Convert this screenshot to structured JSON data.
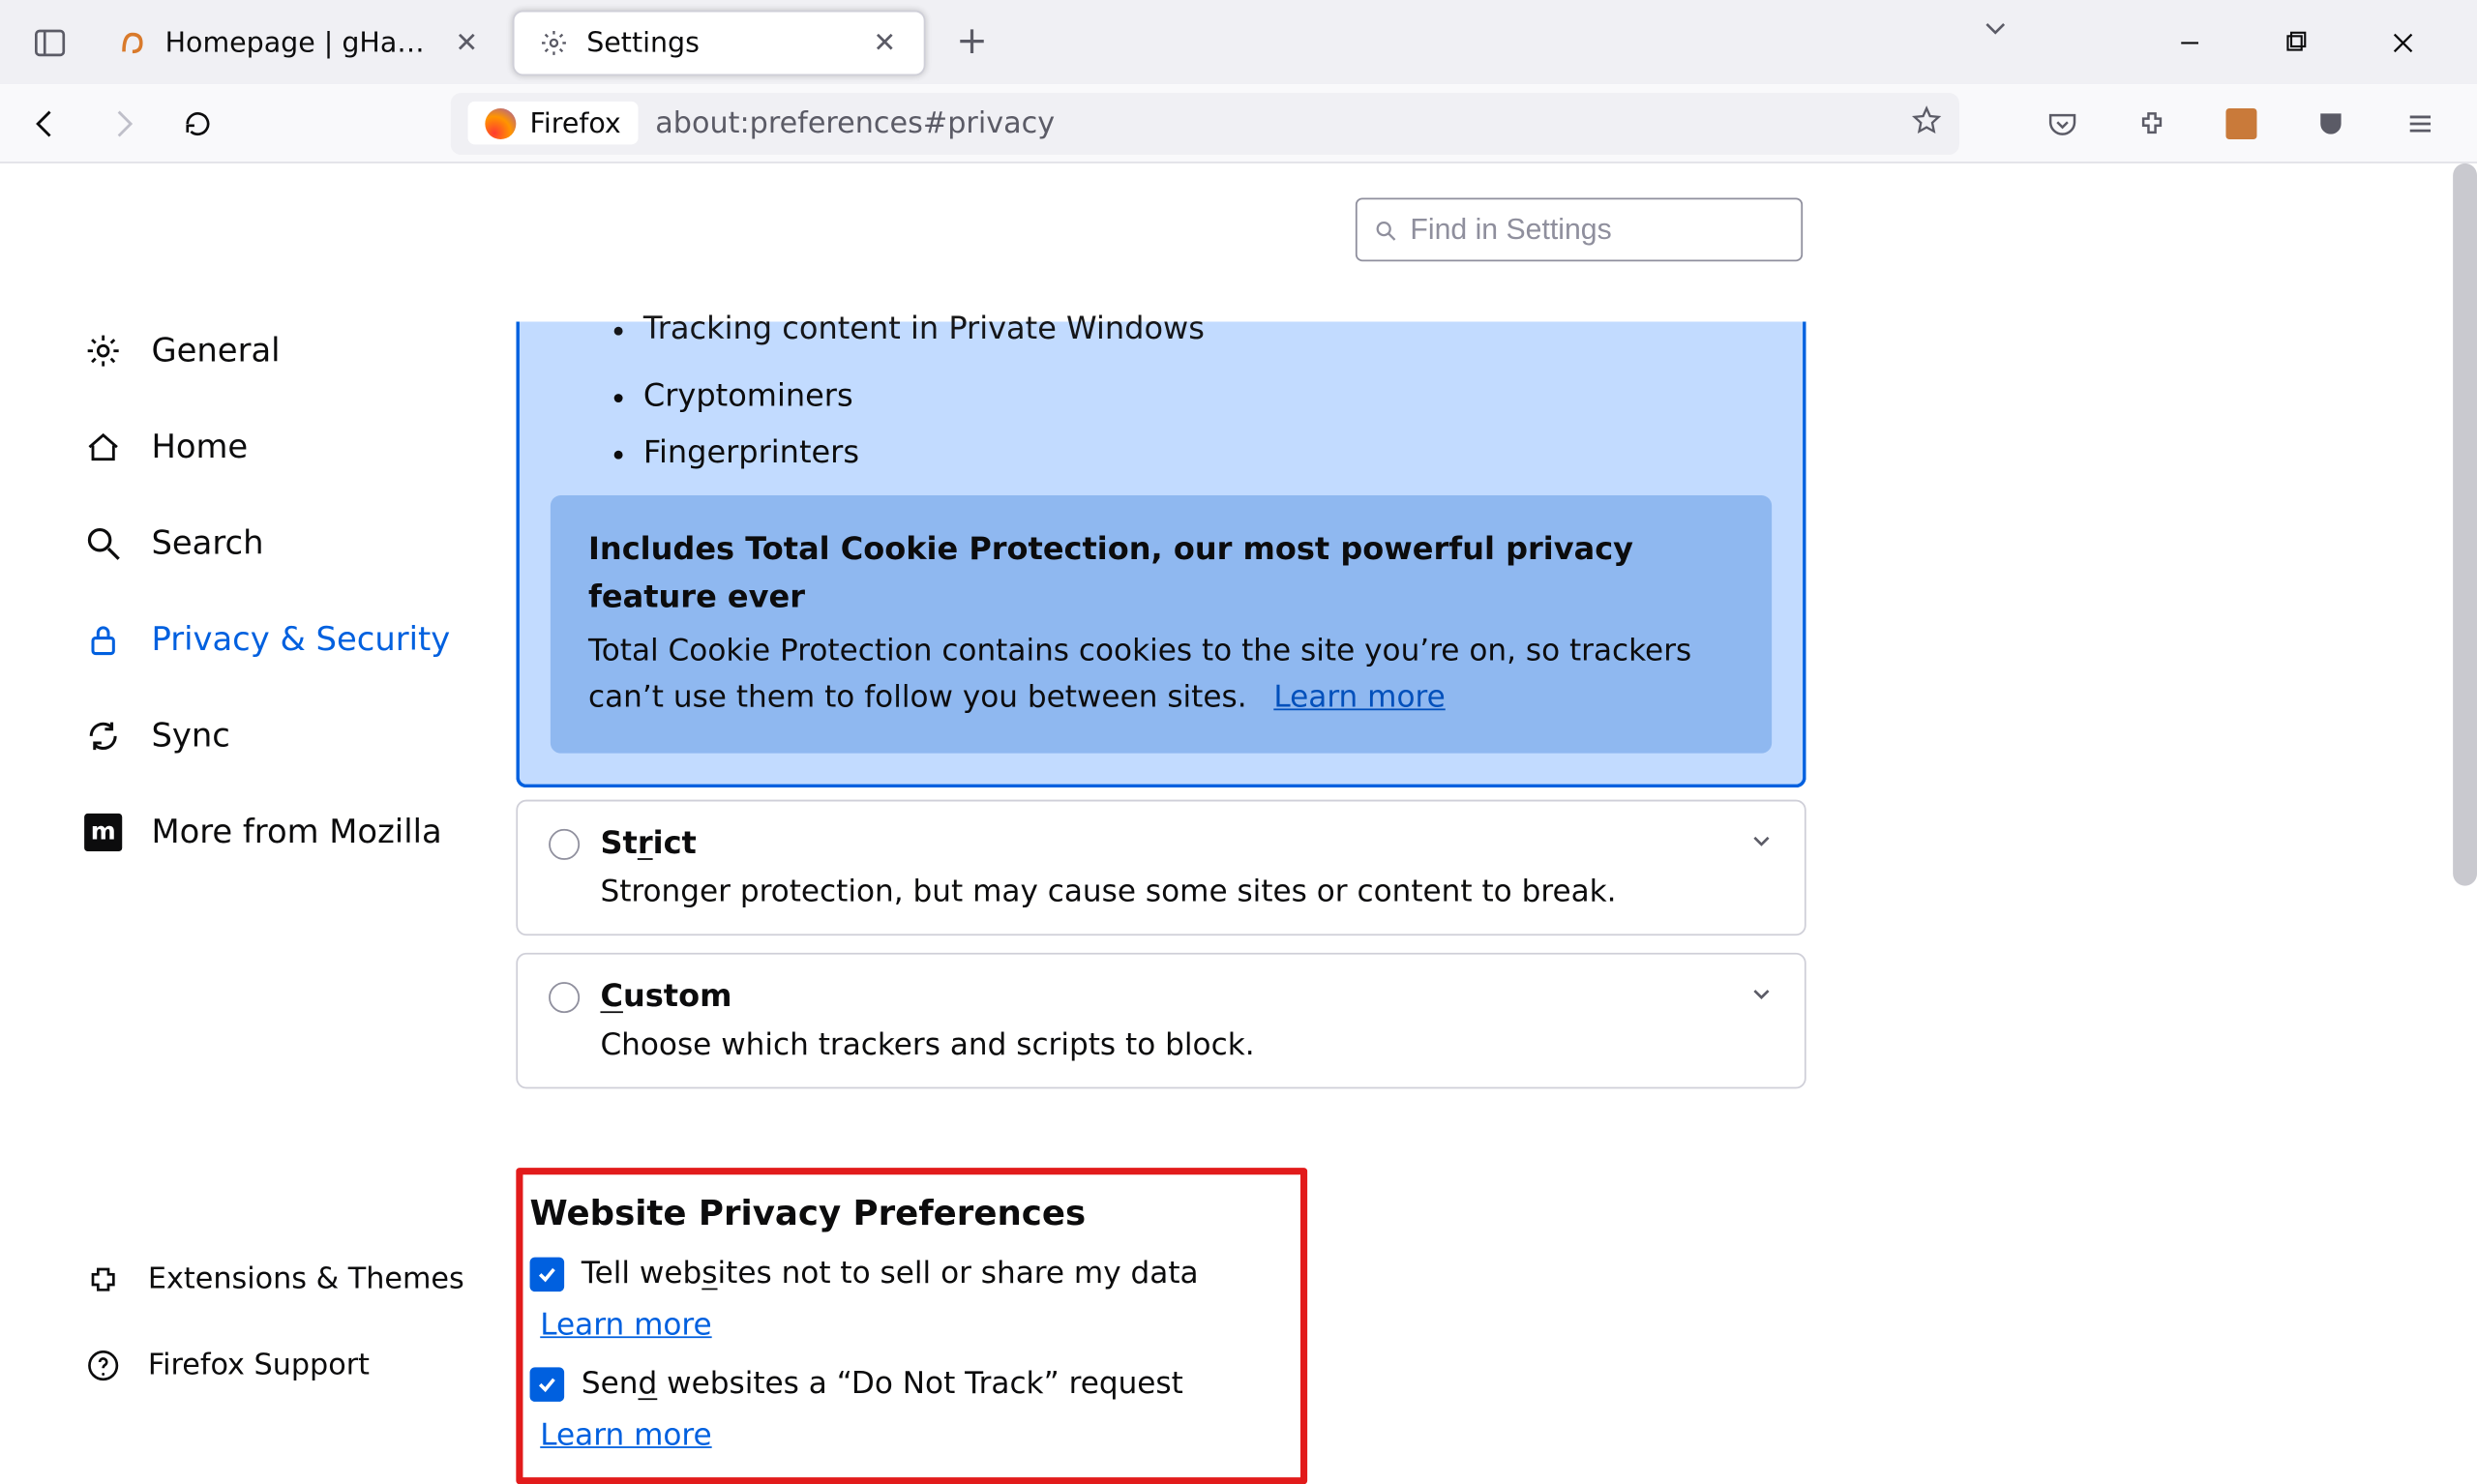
{
  "tabs": {
    "inactive": {
      "label": "Homepage | gHacks Technolog"
    },
    "active": {
      "label": "Settings"
    }
  },
  "urlbar": {
    "identity": "Firefox",
    "address": "about:preferences#privacy"
  },
  "search": {
    "placeholder": "Find in Settings"
  },
  "sidebar": {
    "items": [
      {
        "label": "General"
      },
      {
        "label": "Home"
      },
      {
        "label": "Search"
      },
      {
        "label": "Privacy & Security"
      },
      {
        "label": "Sync"
      },
      {
        "label": "More from Mozilla"
      }
    ]
  },
  "bottom": {
    "ext": "Extensions & Themes",
    "support": "Firefox Support"
  },
  "etp": {
    "bullets": [
      "Tracking content in Private Windows",
      "Cryptominers",
      "Fingerprinters"
    ],
    "tcp_title": "Includes Total Cookie Protection, our most powerful privacy feature ever",
    "tcp_body": "Total Cookie Protection contains cookies to the site you’re on, so trackers can’t use them to follow you between sites.",
    "tcp_learn": "Learn more"
  },
  "strict": {
    "title_pre": "St",
    "title_u": "r",
    "title_post": "ict",
    "desc": "Stronger protection, but may cause some sites or content to break."
  },
  "custom": {
    "title_u": "C",
    "title_post": "ustom",
    "desc": "Choose which trackers and scripts to block."
  },
  "wpp": {
    "heading": "Website Privacy Preferences",
    "opt1_pre": "Tell web",
    "opt1_u": "s",
    "opt1_post": "ites not to sell or share my data",
    "opt1_learn": "Learn more",
    "opt2_pre": "Sen",
    "opt2_u": "d",
    "opt2_post": " websites a “Do Not Track” request",
    "opt2_learn": "Learn more"
  }
}
